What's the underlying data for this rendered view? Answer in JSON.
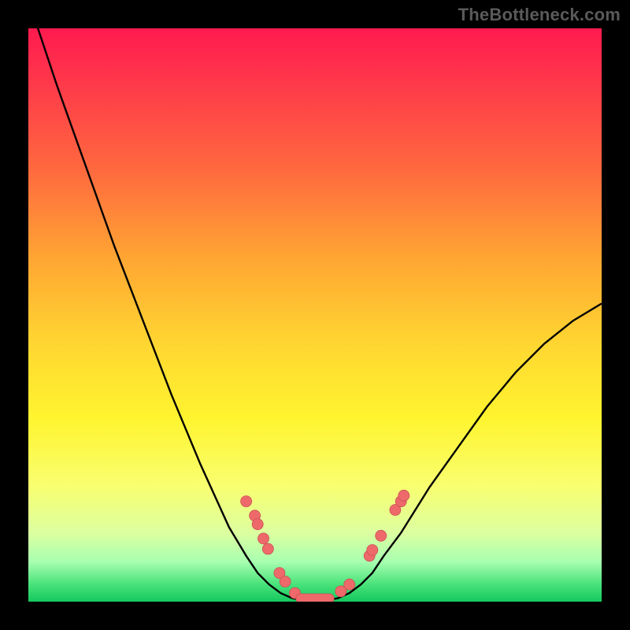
{
  "watermark": "TheBottleneck.com",
  "colors": {
    "frame_bg": "#000000",
    "watermark_text": "#5a5a5a",
    "curve_stroke": "#000000",
    "marker_fill": "#ee6a6a",
    "marker_stroke": "#cc4f55"
  },
  "chart_data": {
    "type": "line",
    "title": "",
    "xlabel": "",
    "ylabel": "",
    "x": [
      0.0,
      0.05,
      0.1,
      0.15,
      0.2,
      0.25,
      0.3,
      0.35,
      0.38,
      0.4,
      0.42,
      0.44,
      0.46,
      0.48,
      0.5,
      0.52,
      0.54,
      0.56,
      0.58,
      0.6,
      0.62,
      0.65,
      0.7,
      0.75,
      0.8,
      0.85,
      0.9,
      0.95,
      1.0
    ],
    "series": [
      {
        "name": "curve",
        "values": [
          1.05,
          0.9,
          0.76,
          0.62,
          0.49,
          0.36,
          0.24,
          0.13,
          0.08,
          0.05,
          0.03,
          0.015,
          0.006,
          0.002,
          0.0,
          0.002,
          0.006,
          0.015,
          0.03,
          0.05,
          0.08,
          0.12,
          0.2,
          0.27,
          0.34,
          0.4,
          0.45,
          0.49,
          0.52
        ]
      }
    ],
    "markers": {
      "left": [
        {
          "x": 0.38,
          "y": 0.175
        },
        {
          "x": 0.395,
          "y": 0.15
        },
        {
          "x": 0.4,
          "y": 0.135
        },
        {
          "x": 0.41,
          "y": 0.11
        },
        {
          "x": 0.418,
          "y": 0.092
        },
        {
          "x": 0.438,
          "y": 0.05
        },
        {
          "x": 0.448,
          "y": 0.035
        },
        {
          "x": 0.465,
          "y": 0.015
        }
      ],
      "right": [
        {
          "x": 0.545,
          "y": 0.018
        },
        {
          "x": 0.56,
          "y": 0.03
        },
        {
          "x": 0.595,
          "y": 0.08
        },
        {
          "x": 0.6,
          "y": 0.09
        },
        {
          "x": 0.615,
          "y": 0.115
        },
        {
          "x": 0.64,
          "y": 0.16
        },
        {
          "x": 0.65,
          "y": 0.175
        },
        {
          "x": 0.655,
          "y": 0.185
        }
      ],
      "bottom": [
        {
          "x": 0.475,
          "y": 0.006
        },
        {
          "x": 0.492,
          "y": 0.001
        },
        {
          "x": 0.508,
          "y": 0.001
        },
        {
          "x": 0.525,
          "y": 0.005
        }
      ]
    },
    "xlim": [
      0,
      1
    ],
    "ylim": [
      0,
      1
    ],
    "grid": false,
    "legend": false
  }
}
